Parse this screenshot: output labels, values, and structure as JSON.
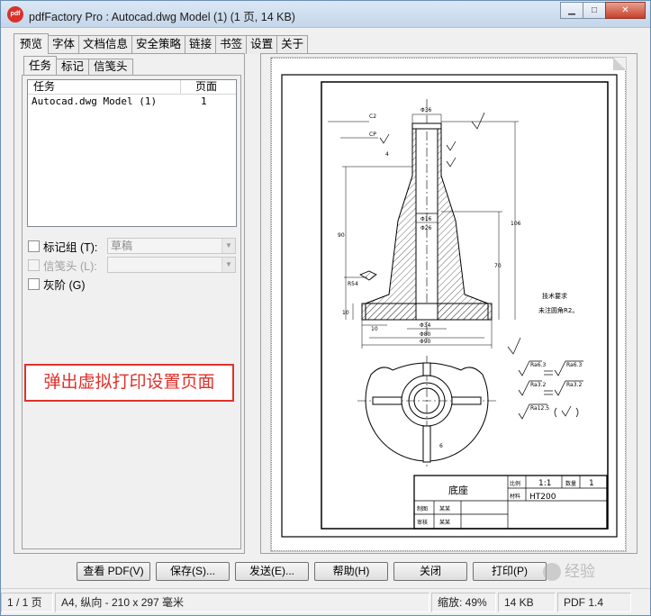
{
  "window": {
    "title": "pdfFactory Pro : Autocad.dwg Model (1) (1 页, 14 KB)",
    "app_icon_text": "pdf",
    "minimize_glyph": "▁",
    "maximize_glyph": "□",
    "close_glyph": "✕"
  },
  "main_tabs": [
    {
      "label": "预览"
    },
    {
      "label": "字体"
    },
    {
      "label": "文档信息"
    },
    {
      "label": "安全策略"
    },
    {
      "label": "链接"
    },
    {
      "label": "书签"
    },
    {
      "label": "设置"
    },
    {
      "label": "关于"
    }
  ],
  "sub_tabs": [
    {
      "label": "任务"
    },
    {
      "label": "标记"
    },
    {
      "label": "信笺头"
    }
  ],
  "task_list": {
    "headers": [
      "任务",
      "页面"
    ],
    "rows": [
      {
        "name": "Autocad.dwg Model (1)",
        "pages": "1"
      }
    ]
  },
  "options": {
    "mark_group_label": "标记组 (T):",
    "mark_group_value": "草稿",
    "letterhead_label": "信笺头 (L):",
    "letterhead_value": "",
    "grayscale_label": "灰阶 (G)"
  },
  "annotation": "弹出虚拟打印设置页面",
  "drawing": {
    "title_block": {
      "part_name": "底座",
      "scale_label": "比例",
      "scale_value": "1:1",
      "qty_label": "数量",
      "qty_value": "1",
      "material_label": "材料",
      "material_value": "HT200",
      "drawn_label": "制图",
      "checked_label": "审核",
      "drawn_name": "某某",
      "checked_name": "某某"
    },
    "tech_req_title": "技术要求",
    "tech_req_text": "未注圆角R2。",
    "roughness": [
      "Ra6.3",
      "Ra3.2",
      "Ra12.5"
    ],
    "dim_labels": [
      "C2",
      "CP",
      "4",
      "Φ36",
      "Φ16",
      "Φ26",
      "90",
      "106",
      "70",
      "R54",
      "10",
      "Φ34",
      "Φ80",
      "Φ90",
      "6"
    ]
  },
  "buttons": {
    "view_pdf": "查看 PDF(V)",
    "save": "保存(S)...",
    "send": "发送(E)...",
    "help": "帮助(H)",
    "close": "关闭",
    "print": "打印(P)"
  },
  "watermark": "经验",
  "status": {
    "page": "1 / 1 页",
    "paper": "A4, 纵向 - 210 x 297 毫米",
    "zoom": "缩放: 49%",
    "size": "14 KB",
    "pdf_version": "PDF 1.4"
  }
}
